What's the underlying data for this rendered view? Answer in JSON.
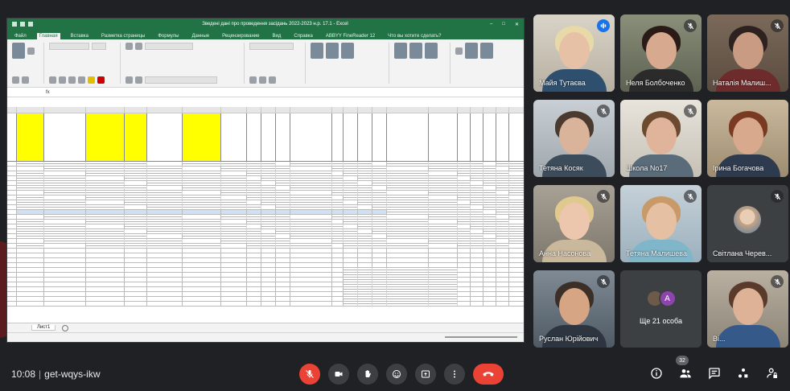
{
  "excel": {
    "window_title": "Зведені дані про проведення засідань 2022-2023 н.р. 17.1 - Excel",
    "tabs": [
      "Файл",
      "Главная",
      "Вставка",
      "Разметка страницы",
      "Формулы",
      "Данные",
      "Рецензирование",
      "Вид",
      "Справка",
      "ABBYY FineReader 12",
      "Что вы хотите сделать?"
    ],
    "active_tab_index": 1,
    "sheet_tab": "Лист1",
    "accent_color": "#217346",
    "header_highlight_color": "#ffff00"
  },
  "participants": [
    {
      "name": "Майя Тутаєва",
      "muted": false,
      "speaking": true
    },
    {
      "name": "Неля Болбоченко",
      "muted": true
    },
    {
      "name": "Наталія Малиш...",
      "muted": true
    },
    {
      "name": "Тетяна Косяк",
      "muted": true
    },
    {
      "name": "Школа No17",
      "muted": true
    },
    {
      "name": "Ірина Богачова",
      "muted": false
    },
    {
      "name": "Анна Насонова",
      "muted": true
    },
    {
      "name": "Тетяна Малишева",
      "muted": true
    },
    {
      "name": "Світлана Черев...",
      "muted": true
    },
    {
      "name": "Руслан Юрійович",
      "muted": true
    },
    {
      "name": "Ще 21 особа",
      "avatar_letter": "A"
    },
    {
      "name": "Ві...",
      "muted": true
    }
  ],
  "bottom_bar": {
    "time": "10:08",
    "meeting_code": "get-wqys-ikw",
    "participants_count": "32"
  }
}
